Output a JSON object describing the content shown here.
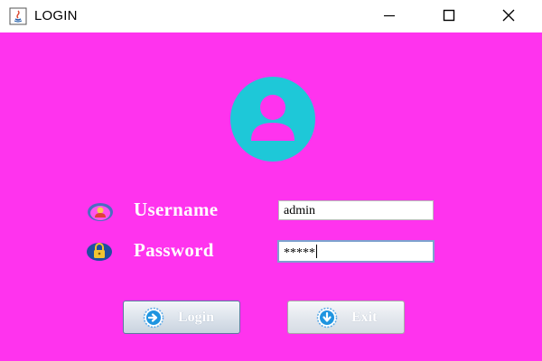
{
  "window": {
    "title": "LOGIN",
    "icon": "java-app-icon",
    "controls": [
      "minimize-icon",
      "maximize-icon",
      "close-icon"
    ]
  },
  "form": {
    "avatar_icon": "user-avatar-icon",
    "username": {
      "label": "Username",
      "value": "admin",
      "icon": "user-icon"
    },
    "password": {
      "label": "Password",
      "value": "*****",
      "icon": "lock-icon"
    }
  },
  "buttons": {
    "login_label": "Login",
    "login_icon": "login-arrow-icon",
    "exit_label": "Exit",
    "exit_icon": "exit-arrow-icon"
  },
  "colors": {
    "background": "#ff33ee",
    "avatar": "#1ec8d8",
    "label_text": "#ffffff"
  }
}
